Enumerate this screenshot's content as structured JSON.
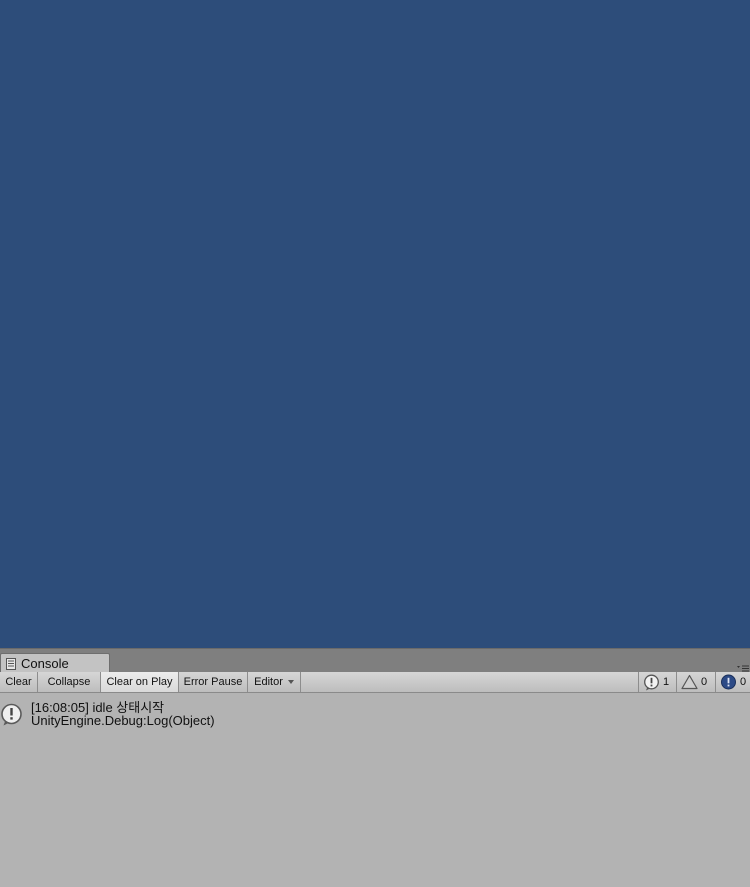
{
  "console": {
    "tab_label": "Console",
    "toolbar": {
      "clear": "Clear",
      "collapse": "Collapse",
      "clear_on_play": "Clear on Play",
      "error_pause": "Error Pause",
      "editor": "Editor"
    },
    "counts": {
      "log": "1",
      "warning": "0",
      "error": "0"
    },
    "entries": [
      {
        "icon": "info-icon",
        "message": "[16:08:05] idle 상태시작",
        "stack": "UnityEngine.Debug:Log(Object)"
      }
    ]
  },
  "colors": {
    "viewport_background": "#2d4d7a",
    "console_background": "#b3b3b3"
  }
}
